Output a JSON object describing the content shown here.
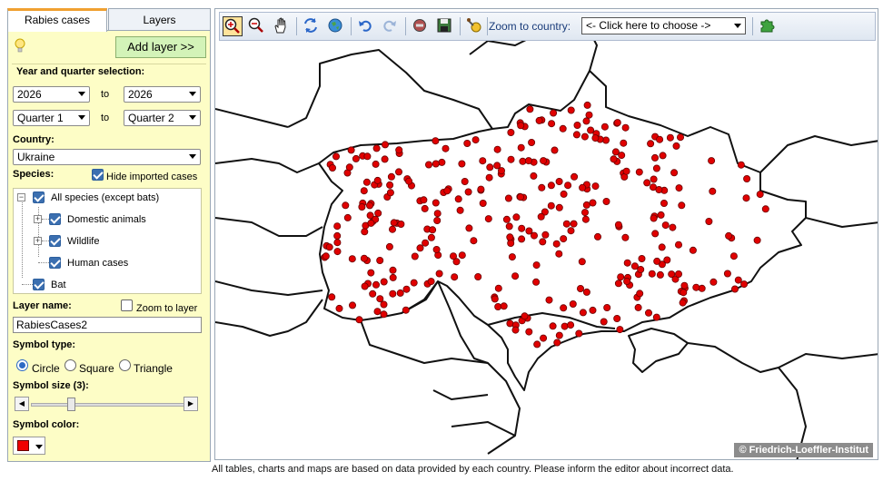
{
  "tabs": {
    "rabies": "Rabies cases",
    "layers": "Layers"
  },
  "panel": {
    "add_layer": "Add layer >>",
    "year_quarter_heading": "Year and quarter selection:",
    "year_from": "2026",
    "year_to": "2026",
    "to_label": "to",
    "quarter_from": "Quarter 1",
    "quarter_to": "Quarter 2",
    "country_label": "Country:",
    "country": "Ukraine",
    "species_label": "Species:",
    "hide_imported": "Hide imported cases",
    "hide_imported_checked": true,
    "tree": [
      {
        "label": "All species (except bats)",
        "checked": true
      },
      {
        "label": "Domestic animals",
        "checked": true
      },
      {
        "label": "Wildlife",
        "checked": true
      },
      {
        "label": "Human cases",
        "checked": true
      },
      {
        "label": "Bat",
        "checked": true
      }
    ],
    "layer_name_label": "Layer name:",
    "zoom_to_layer": "Zoom to layer",
    "layer_name": "RabiesCases2",
    "symbol_type_label": "Symbol type:",
    "symbol_types": [
      "Circle",
      "Square",
      "Triangle"
    ],
    "symbol_type_selected": "Circle",
    "symbol_size_label": "Symbol size (3):",
    "symbol_size": 3,
    "symbol_color_label": "Symbol color:",
    "symbol_color": "#f00000"
  },
  "toolbar": {
    "icons": [
      "zoom-in-icon",
      "zoom-out-icon",
      "pan-hand-icon",
      "refresh-icon",
      "globe-icon",
      "undo-icon",
      "redo-icon",
      "stop-icon",
      "save-icon",
      "identify-icon",
      "puzzle-icon"
    ],
    "zoom_to_country_label": "Zoom to country:",
    "zoom_to_country_value": "<- Click here to choose ->"
  },
  "map": {
    "credit": "© Friedrich-Loeffler-Institut",
    "case_color": "#e00000"
  },
  "footer": "All tables, charts and maps are based on data provided by each country. Please inform the editor about incorrect data."
}
